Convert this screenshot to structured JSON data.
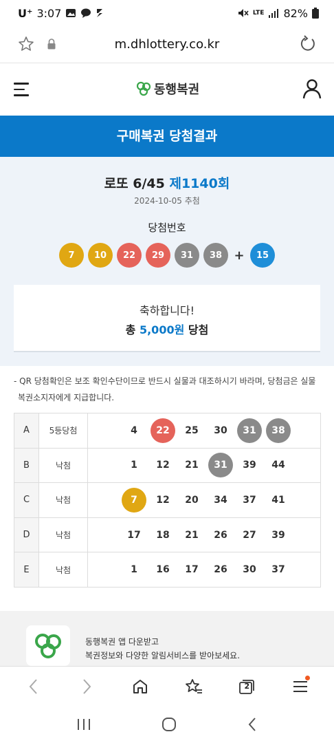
{
  "status_bar": {
    "carrier": "U⁺",
    "time": "3:07",
    "network": "LTE",
    "battery": "82%"
  },
  "browser": {
    "url": "m.dhlottery.co.kr"
  },
  "site": {
    "logo_text": "동행복권"
  },
  "banner": {
    "title": "구매복권 당첨결과"
  },
  "result": {
    "game": "로또 6/45",
    "round": "제1140회",
    "draw_date": "2024-10-05 추첨",
    "winning_label": "당첨번호",
    "winning_numbers": [
      {
        "n": "7",
        "color": "#e0a713"
      },
      {
        "n": "10",
        "color": "#e0a713"
      },
      {
        "n": "22",
        "color": "#e5635a"
      },
      {
        "n": "29",
        "color": "#e5635a"
      },
      {
        "n": "31",
        "color": "#8a8a8a"
      },
      {
        "n": "38",
        "color": "#8a8a8a"
      }
    ],
    "plus": "+",
    "bonus": {
      "n": "15",
      "color": "#1f8ed8"
    },
    "congrats": "축하합니다!",
    "prize_prefix": "총",
    "prize_amount": "5,000원",
    "prize_suffix": "당첨"
  },
  "notice": {
    "line1": "- QR 당첨확인은 보조 확인수단이므로 반드시 실물과 대조하시기 바라며, 당첨금은 실물",
    "line2": "복권소지자에게 지급합니다."
  },
  "ticket": {
    "rows": [
      {
        "label": "A",
        "result": "5등당첨",
        "numbers": [
          {
            "n": "4"
          },
          {
            "n": "22",
            "color": "#e5635a"
          },
          {
            "n": "25"
          },
          {
            "n": "30"
          },
          {
            "n": "31",
            "color": "#8a8a8a"
          },
          {
            "n": "38",
            "color": "#8a8a8a"
          }
        ]
      },
      {
        "label": "B",
        "result": "낙첨",
        "numbers": [
          {
            "n": "1"
          },
          {
            "n": "12"
          },
          {
            "n": "21"
          },
          {
            "n": "31",
            "color": "#8a8a8a"
          },
          {
            "n": "39"
          },
          {
            "n": "44"
          }
        ]
      },
      {
        "label": "C",
        "result": "낙첨",
        "numbers": [
          {
            "n": "7",
            "color": "#e0a713"
          },
          {
            "n": "12"
          },
          {
            "n": "20"
          },
          {
            "n": "34"
          },
          {
            "n": "37"
          },
          {
            "n": "41"
          }
        ]
      },
      {
        "label": "D",
        "result": "낙첨",
        "numbers": [
          {
            "n": "17"
          },
          {
            "n": "18"
          },
          {
            "n": "21"
          },
          {
            "n": "26"
          },
          {
            "n": "27"
          },
          {
            "n": "39"
          }
        ]
      },
      {
        "label": "E",
        "result": "낙첨",
        "numbers": [
          {
            "n": "1"
          },
          {
            "n": "16"
          },
          {
            "n": "17"
          },
          {
            "n": "26"
          },
          {
            "n": "30"
          },
          {
            "n": "37"
          }
        ]
      }
    ]
  },
  "promo": {
    "line1": "동행복권 앱 다운받고",
    "line2": "복권정보와 다양한 알림서비스를 받아보세요."
  },
  "browser_nav": {
    "tab_count": "2"
  },
  "colors": {
    "brand_blue": "#0b79c9",
    "logo_green": "#3aa64a",
    "badge_orange": "#f05a22"
  }
}
